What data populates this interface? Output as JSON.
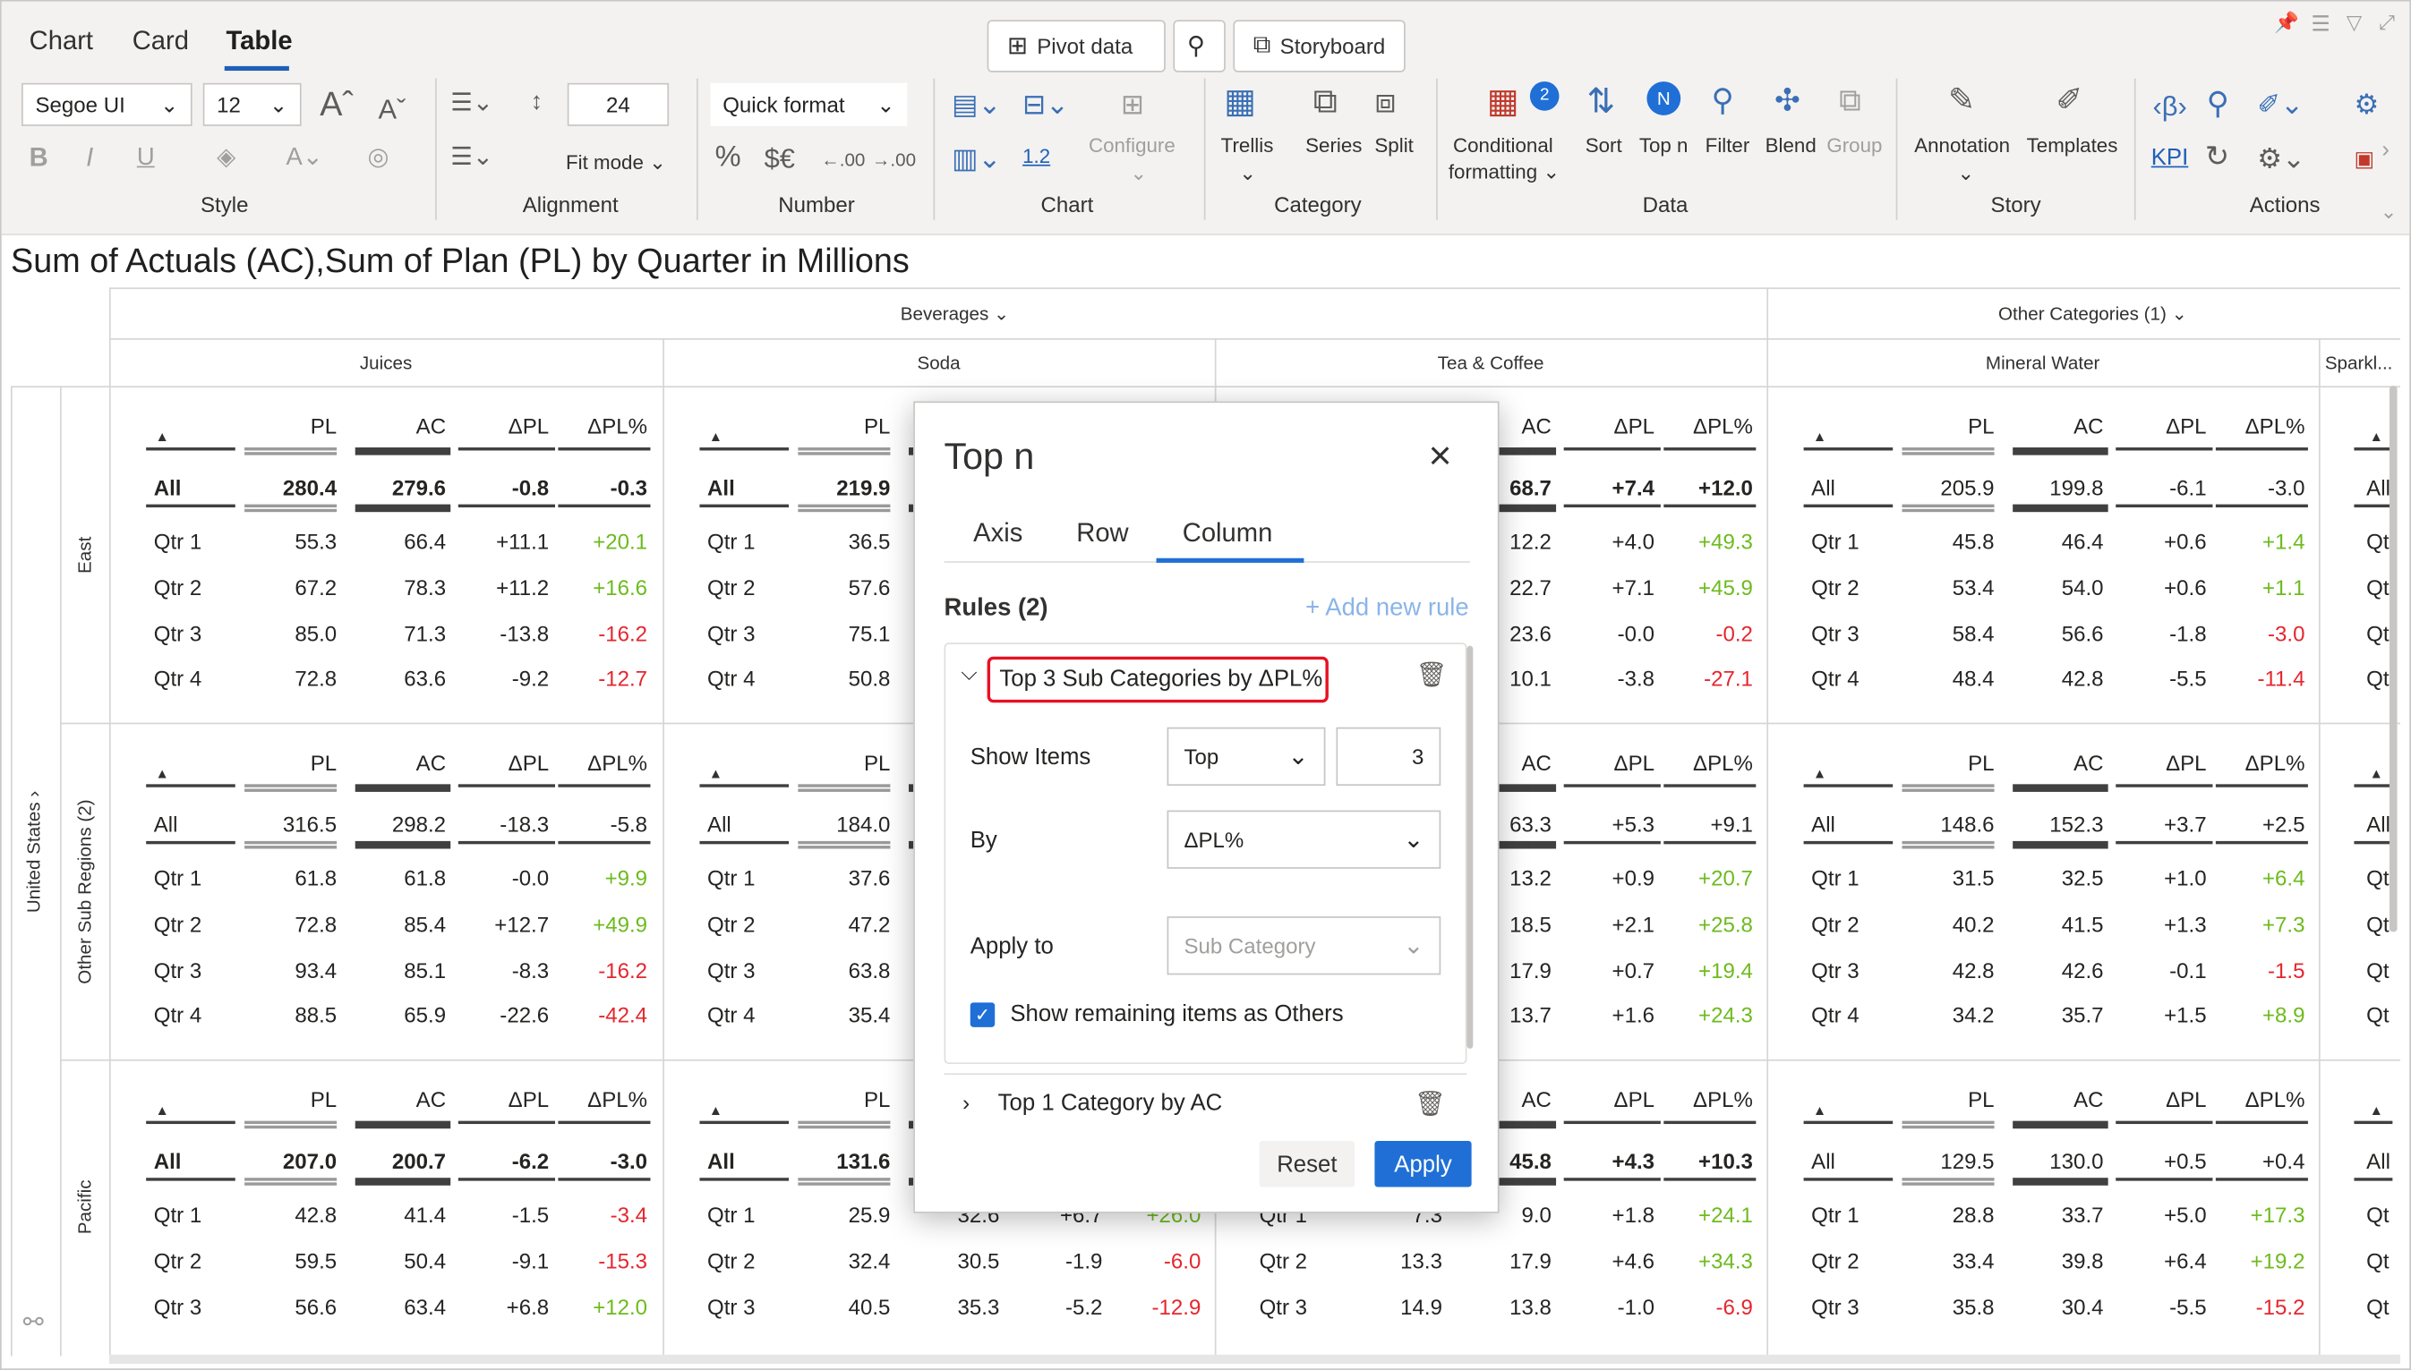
{
  "main_tabs": [
    "Chart",
    "Card",
    "Table"
  ],
  "top_buttons": {
    "pivot": "Pivot data",
    "storyboard": "Storyboard"
  },
  "style": {
    "font": "Segoe UI",
    "size": "12",
    "label": "Style"
  },
  "alignment": {
    "height": "24",
    "fit": "Fit mode",
    "label": "Alignment"
  },
  "number": {
    "quick_format": "Quick format",
    "label": "Number",
    "percent": "%",
    "currency": "$€",
    "dec_minus": ".00",
    "dec_plus": ".00"
  },
  "chart_group": {
    "configure": "Configure",
    "gap": "1.2",
    "label": "Chart"
  },
  "category_group": {
    "trellis": "Trellis",
    "series": "Series",
    "split": "Split",
    "label": "Category"
  },
  "data_group": {
    "cond1": "Conditional",
    "cond2": "formatting",
    "cond_badge": "2",
    "sort": "Sort",
    "topn": "Top n",
    "topn_badge": "N",
    "filter": "Filter",
    "blend": "Blend",
    "group": "Group",
    "label": "Data"
  },
  "story_group": {
    "annotation": "Annotation",
    "templates": "Templates",
    "label": "Story"
  },
  "actions_group": {
    "kpi": "KPI",
    "label": "Actions"
  },
  "chart_title": "Sum of Actuals (AC),Sum of Plan (PL) by Quarter in Millions",
  "col_groups": {
    "beverages": "Beverages",
    "other": "Other Categories (1)"
  },
  "sub_headers": [
    "Juices",
    "Soda",
    "Tea & Coffee",
    "Mineral Water",
    "Sparkl..."
  ],
  "measure_headers": [
    "PL",
    "AC",
    "ΔPL",
    "ΔPL%"
  ],
  "row_outer": "United States",
  "regions": [
    "East",
    "Other Sub Regions (2)",
    "Pacific"
  ],
  "row_labels": [
    "All",
    "Qtr 1",
    "Qtr 2",
    "Qtr 3",
    "Qtr 4"
  ],
  "data_rows": {
    "juices": [
      [
        [
          "280.4",
          "279.6",
          "-0.8",
          "-0.3"
        ],
        [
          "55.3",
          "66.4",
          "+11.1",
          "+20.1"
        ],
        [
          "67.2",
          "78.3",
          "+11.2",
          "+16.6"
        ],
        [
          "85.0",
          "71.3",
          "-13.8",
          "-16.2"
        ],
        [
          "72.8",
          "63.6",
          "-9.2",
          "-12.7"
        ]
      ],
      [
        [
          "316.5",
          "298.2",
          "-18.3",
          "-5.8"
        ],
        [
          "61.8",
          "61.8",
          "-0.0",
          "+9.9"
        ],
        [
          "72.8",
          "85.4",
          "+12.7",
          "+49.9"
        ],
        [
          "93.4",
          "85.1",
          "-8.3",
          "-16.2"
        ],
        [
          "88.5",
          "65.9",
          "-22.6",
          "-42.4"
        ]
      ],
      [
        [
          "207.0",
          "200.7",
          "-6.2",
          "-3.0"
        ],
        [
          "42.8",
          "41.4",
          "-1.5",
          "-3.4"
        ],
        [
          "59.5",
          "50.4",
          "-9.1",
          "-15.3"
        ],
        [
          "56.6",
          "63.4",
          "+6.8",
          "+12.0"
        ]
      ]
    ],
    "soda": [
      [
        [
          "219.9"
        ],
        [
          "36.5"
        ],
        [
          "57.6"
        ],
        [
          "75.1"
        ],
        [
          "50.8"
        ]
      ],
      [
        [
          "184.0"
        ],
        [
          "37.6"
        ],
        [
          "47.2"
        ],
        [
          "63.8"
        ],
        [
          "35.4"
        ]
      ],
      [
        [
          "131.6"
        ],
        [
          "25.9",
          "32.6",
          "+6.7",
          "+26.0"
        ],
        [
          "32.4",
          "30.5",
          "-1.9",
          "-6.0"
        ],
        [
          "40.5",
          "35.3",
          "-5.2",
          "-12.9"
        ]
      ]
    ],
    "tea": [
      [
        [
          "68.7",
          "+7.4",
          "+12.0"
        ],
        [
          "12.2",
          "+4.0",
          "+49.3"
        ],
        [
          "22.7",
          "+7.1",
          "+45.9"
        ],
        [
          "23.6",
          "-0.0",
          "-0.2"
        ],
        [
          "10.1",
          "-3.8",
          "-27.1"
        ]
      ],
      [
        [
          "63.3",
          "+5.3",
          "+9.1"
        ],
        [
          "13.2",
          "+0.9",
          "+20.7"
        ],
        [
          "18.5",
          "+2.1",
          "+25.8"
        ],
        [
          "17.9",
          "+0.7",
          "+19.4"
        ],
        [
          "13.7",
          "+1.6",
          "+24.3"
        ]
      ],
      [
        [
          "45.8",
          "+4.3",
          "+10.3"
        ],
        [
          "9.0",
          "+1.8",
          "+24.1"
        ],
        [
          "17.9",
          "+4.6",
          "+34.3"
        ],
        [
          "13.8",
          "-1.0",
          "-6.9"
        ]
      ]
    ],
    "tea_pl_pacific": [
      "7.3",
      "13.3",
      "14.9"
    ],
    "mineral": [
      [
        [
          "205.9",
          "199.8",
          "-6.1",
          "-3.0"
        ],
        [
          "45.8",
          "46.4",
          "+0.6",
          "+1.4"
        ],
        [
          "53.4",
          "54.0",
          "+0.6",
          "+1.1"
        ],
        [
          "58.4",
          "56.6",
          "-1.8",
          "-3.0"
        ],
        [
          "48.4",
          "42.8",
          "-5.5",
          "-11.4"
        ]
      ],
      [
        [
          "148.6",
          "152.3",
          "+3.7",
          "+2.5"
        ],
        [
          "31.5",
          "32.5",
          "+1.0",
          "+6.4"
        ],
        [
          "40.2",
          "41.5",
          "+1.3",
          "+7.3"
        ],
        [
          "42.8",
          "42.6",
          "-0.1",
          "-1.5"
        ],
        [
          "34.2",
          "35.7",
          "+1.5",
          "+8.9"
        ]
      ],
      [
        [
          "129.5",
          "130.0",
          "+0.5",
          "+0.4"
        ],
        [
          "28.8",
          "33.7",
          "+5.0",
          "+17.3"
        ],
        [
          "33.4",
          "39.8",
          "+6.4",
          "+19.2"
        ],
        [
          "35.8",
          "30.4",
          "-5.5",
          "-15.2"
        ]
      ]
    ],
    "sparkl_labels": [
      "All",
      "Qt",
      "Qt",
      "Qt",
      "Qt"
    ]
  },
  "topn": {
    "title": "Top n",
    "tabs": [
      "Axis",
      "Row",
      "Column"
    ],
    "rules_label": "Rules (2)",
    "add_rule": "+ Add new rule",
    "rule1": "Top 3 Sub Categories by ΔPL%",
    "show_items_label": "Show Items",
    "show_items_mode": "Top",
    "show_items_count": "3",
    "by_label": "By",
    "by_value": "ΔPL%",
    "apply_to_label": "Apply to",
    "apply_to_placeholder": "Sub Category",
    "remaining_label": "Show remaining items as Others",
    "rule2": "Top 1 Category by AC",
    "reset": "Reset",
    "apply": "Apply"
  },
  "colors": {
    "accent": "#1f6fd6",
    "positive": "#6dbb1e",
    "negative": "#e5262e",
    "highlight": "#e81123"
  }
}
